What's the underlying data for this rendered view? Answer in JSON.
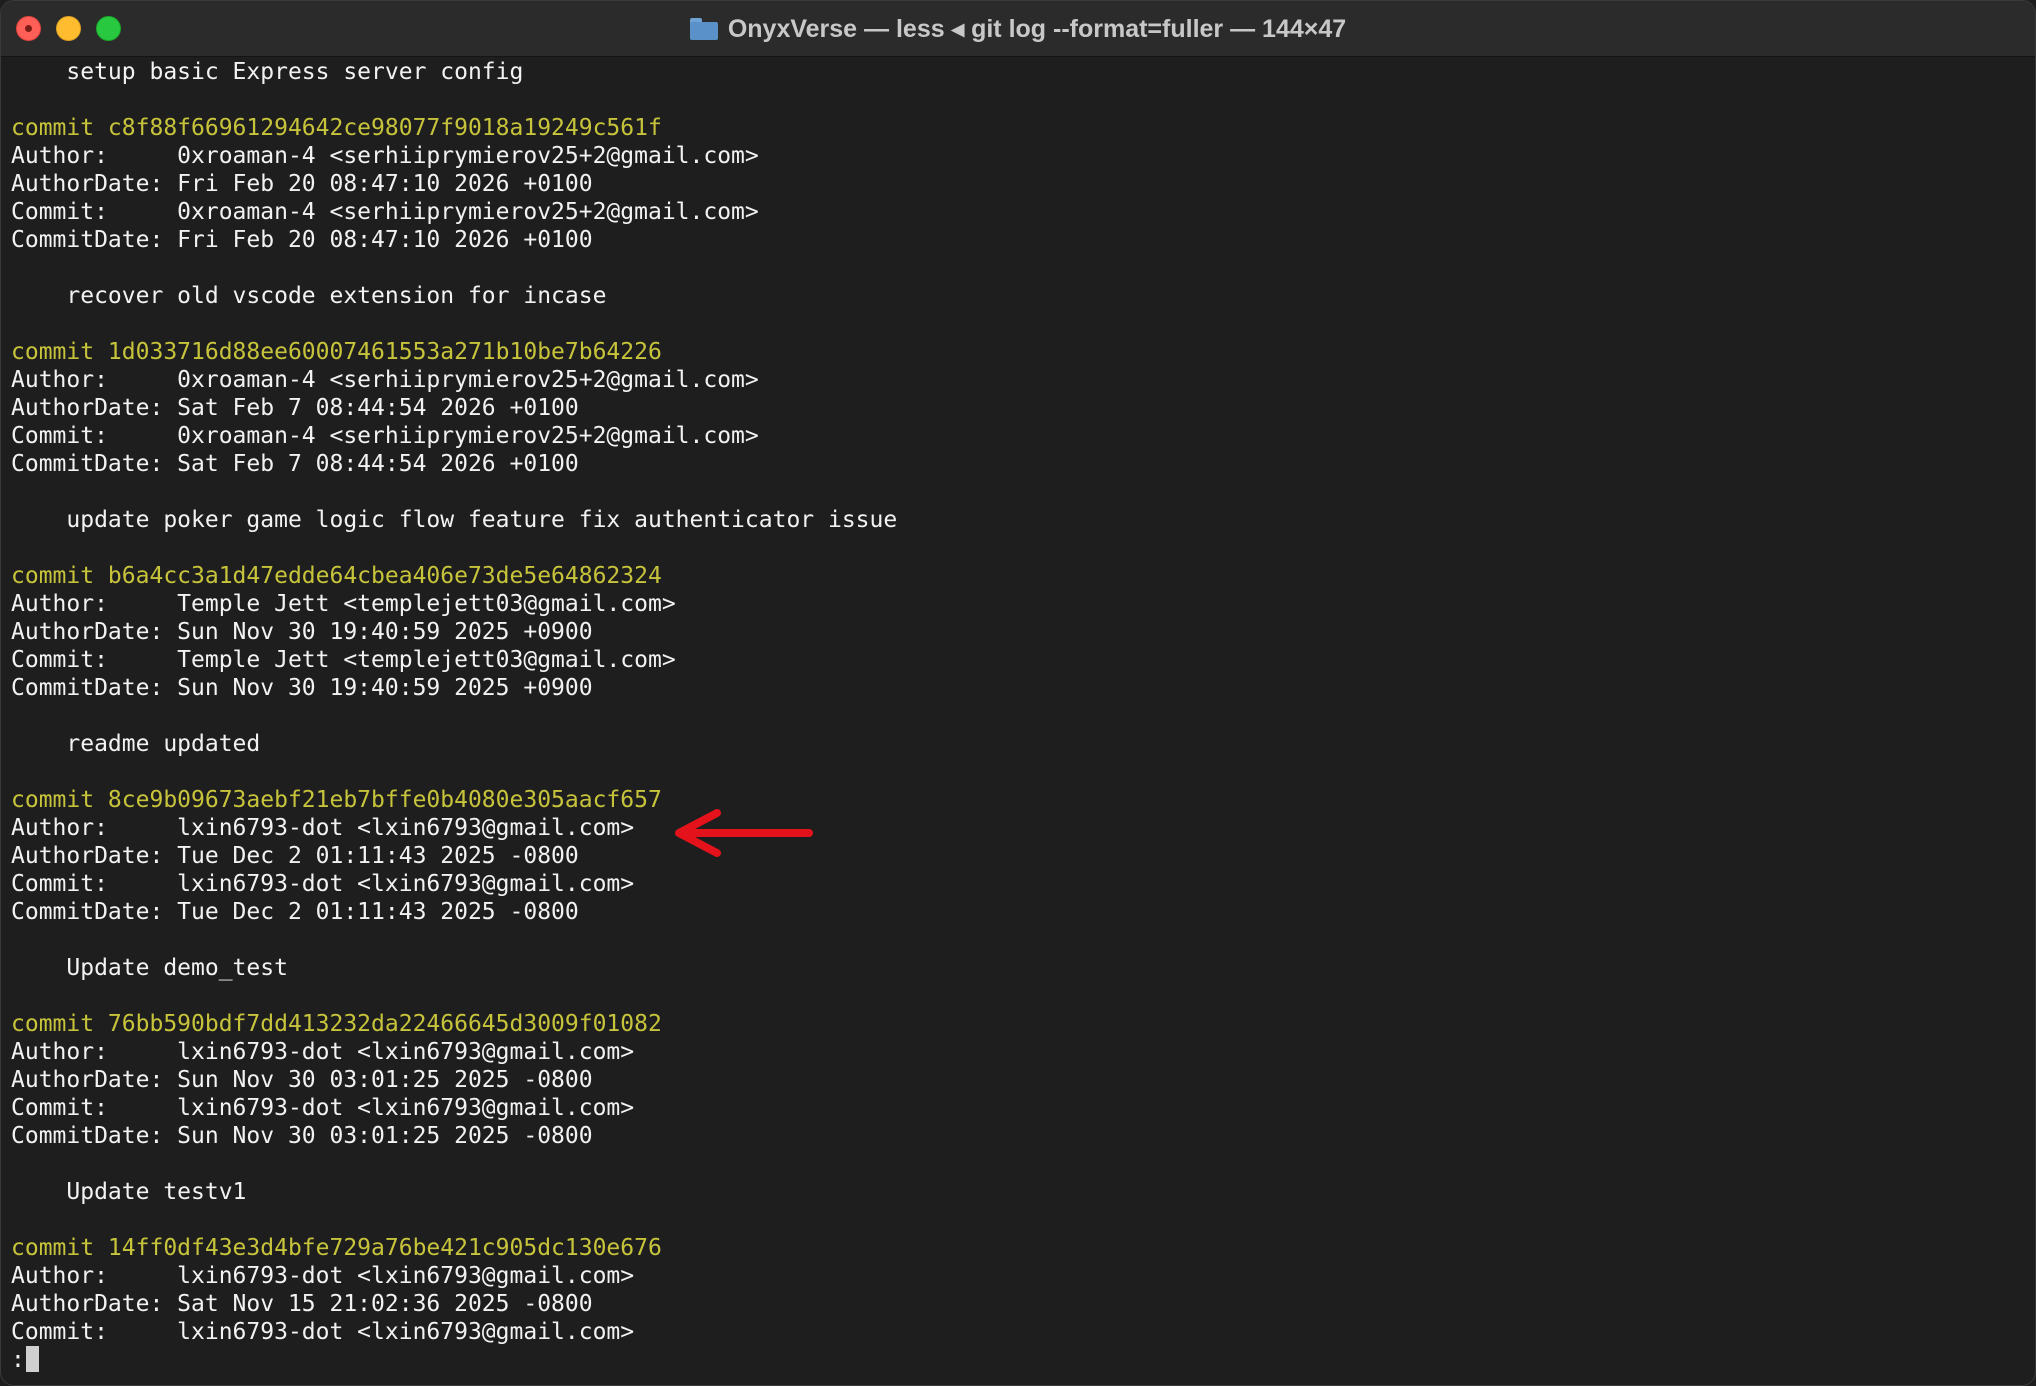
{
  "window": {
    "title": "OnyxVerse — less ◂ git log --format=fuller — 144×47"
  },
  "terminal": {
    "lines": [
      {
        "type": "message",
        "text": "    setup basic Express server config"
      },
      {
        "type": "blank",
        "text": ""
      },
      {
        "type": "commit",
        "text": "commit c8f88f66961294642ce98077f9018a19249c561f"
      },
      {
        "type": "field",
        "text": "Author:     0xroaman-4 <serhiiprymierov25+2@gmail.com>"
      },
      {
        "type": "field",
        "text": "AuthorDate: Fri Feb 20 08:47:10 2026 +0100"
      },
      {
        "type": "field",
        "text": "Commit:     0xroaman-4 <serhiiprymierov25+2@gmail.com>"
      },
      {
        "type": "field",
        "text": "CommitDate: Fri Feb 20 08:47:10 2026 +0100"
      },
      {
        "type": "blank",
        "text": ""
      },
      {
        "type": "message",
        "text": "    recover old vscode extension for incase"
      },
      {
        "type": "blank",
        "text": ""
      },
      {
        "type": "commit",
        "text": "commit 1d033716d88ee60007461553a271b10be7b64226"
      },
      {
        "type": "field",
        "text": "Author:     0xroaman-4 <serhiiprymierov25+2@gmail.com>"
      },
      {
        "type": "field",
        "text": "AuthorDate: Sat Feb 7 08:44:54 2026 +0100"
      },
      {
        "type": "field",
        "text": "Commit:     0xroaman-4 <serhiiprymierov25+2@gmail.com>"
      },
      {
        "type": "field",
        "text": "CommitDate: Sat Feb 7 08:44:54 2026 +0100"
      },
      {
        "type": "blank",
        "text": ""
      },
      {
        "type": "message",
        "text": "    update poker game logic flow feature fix authenticator issue"
      },
      {
        "type": "blank",
        "text": ""
      },
      {
        "type": "commit",
        "text": "commit b6a4cc3a1d47edde64cbea406e73de5e64862324"
      },
      {
        "type": "field",
        "text": "Author:     Temple Jett <templejett03@gmail.com>"
      },
      {
        "type": "field",
        "text": "AuthorDate: Sun Nov 30 19:40:59 2025 +0900"
      },
      {
        "type": "field",
        "text": "Commit:     Temple Jett <templejett03@gmail.com>"
      },
      {
        "type": "field",
        "text": "CommitDate: Sun Nov 30 19:40:59 2025 +0900"
      },
      {
        "type": "blank",
        "text": ""
      },
      {
        "type": "message",
        "text": "    readme updated"
      },
      {
        "type": "blank",
        "text": ""
      },
      {
        "type": "commit",
        "text": "commit 8ce9b09673aebf21eb7bffe0b4080e305aacf657"
      },
      {
        "type": "field",
        "text": "Author:     lxin6793-dot <lxin6793@gmail.com>"
      },
      {
        "type": "field",
        "text": "AuthorDate: Tue Dec 2 01:11:43 2025 -0800"
      },
      {
        "type": "field",
        "text": "Commit:     lxin6793-dot <lxin6793@gmail.com>"
      },
      {
        "type": "field",
        "text": "CommitDate: Tue Dec 2 01:11:43 2025 -0800"
      },
      {
        "type": "blank",
        "text": ""
      },
      {
        "type": "message",
        "text": "    Update demo_test"
      },
      {
        "type": "blank",
        "text": ""
      },
      {
        "type": "commit",
        "text": "commit 76bb590bdf7dd413232da22466645d3009f01082"
      },
      {
        "type": "field",
        "text": "Author:     lxin6793-dot <lxin6793@gmail.com>"
      },
      {
        "type": "field",
        "text": "AuthorDate: Sun Nov 30 03:01:25 2025 -0800"
      },
      {
        "type": "field",
        "text": "Commit:     lxin6793-dot <lxin6793@gmail.com>"
      },
      {
        "type": "field",
        "text": "CommitDate: Sun Nov 30 03:01:25 2025 -0800"
      },
      {
        "type": "blank",
        "text": ""
      },
      {
        "type": "message",
        "text": "    Update testv1"
      },
      {
        "type": "blank",
        "text": ""
      },
      {
        "type": "commit",
        "text": "commit 14ff0df43e3d4bfe729a76be421c905dc130e676"
      },
      {
        "type": "field",
        "text": "Author:     lxin6793-dot <lxin6793@gmail.com>"
      },
      {
        "type": "field",
        "text": "AuthorDate: Sat Nov 15 21:02:36 2025 -0800"
      },
      {
        "type": "field",
        "text": "Commit:     lxin6793-dot <lxin6793@gmail.com>"
      }
    ],
    "prompt": ":"
  },
  "colors": {
    "background": "#1e1e1e",
    "text": "#f2f2f2",
    "commit_hash": "#c7c43b",
    "annotation_arrow": "#e3121b"
  },
  "icons": {
    "title_folder": "folder-icon",
    "annotation": "red-arrow-left-icon"
  }
}
